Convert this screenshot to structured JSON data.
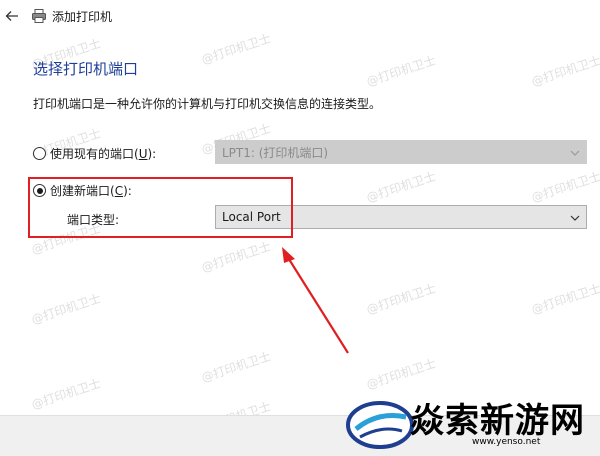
{
  "window": {
    "title": "添加打印机"
  },
  "page": {
    "heading": "选择打印机端口",
    "description": "打印机端口是一种允许你的计算机与打印机交换信息的连接类型。"
  },
  "existing_port": {
    "label_text": "使用现有的端口(",
    "label_accel": "U",
    "label_suffix": "):",
    "selected": false,
    "dropdown_value": "LPT1: (打印机端口)"
  },
  "new_port": {
    "label_text": "创建新端口(",
    "label_accel": "C",
    "label_suffix": "):",
    "selected": true,
    "type_label": "端口类型:",
    "dropdown_value": "Local Port"
  },
  "watermark": {
    "text": "@打印机卫士"
  },
  "brand": {
    "name": "焱索新游网",
    "url": "www.yenso.net"
  },
  "colors": {
    "heading": "#1f3e9a",
    "highlight": "#e02020"
  },
  "icons": {
    "back": "back-arrow-icon",
    "printer": "printer-icon",
    "dropdown": "chevron-down-icon"
  }
}
